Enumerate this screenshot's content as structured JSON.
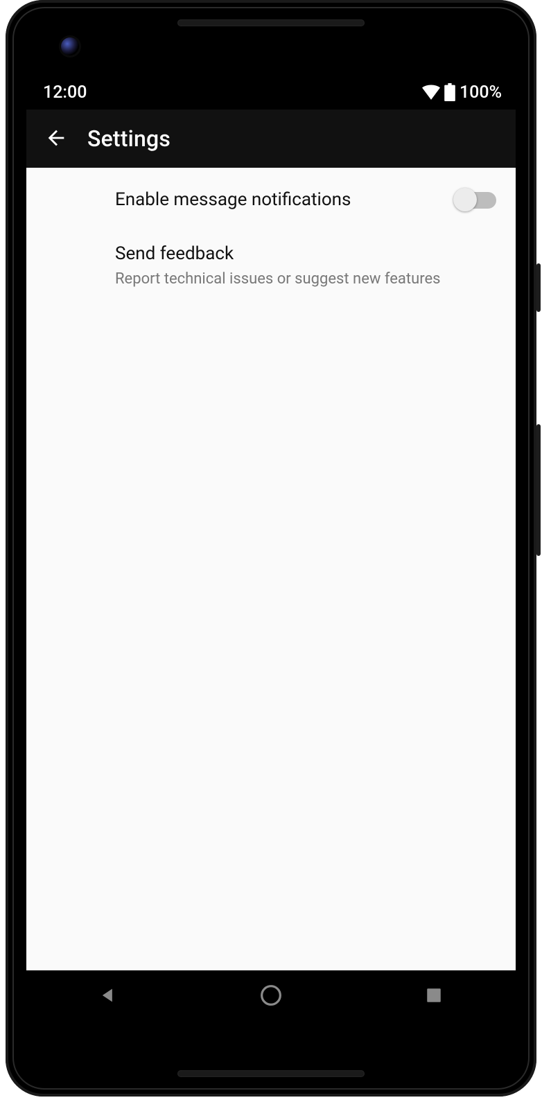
{
  "statusBar": {
    "time": "12:00",
    "battery": "100%"
  },
  "appBar": {
    "title": "Settings"
  },
  "settings": {
    "items": [
      {
        "title": "Enable message notifications"
      },
      {
        "title": "Send feedback",
        "sub": "Report technical issues or suggest new features"
      }
    ]
  }
}
